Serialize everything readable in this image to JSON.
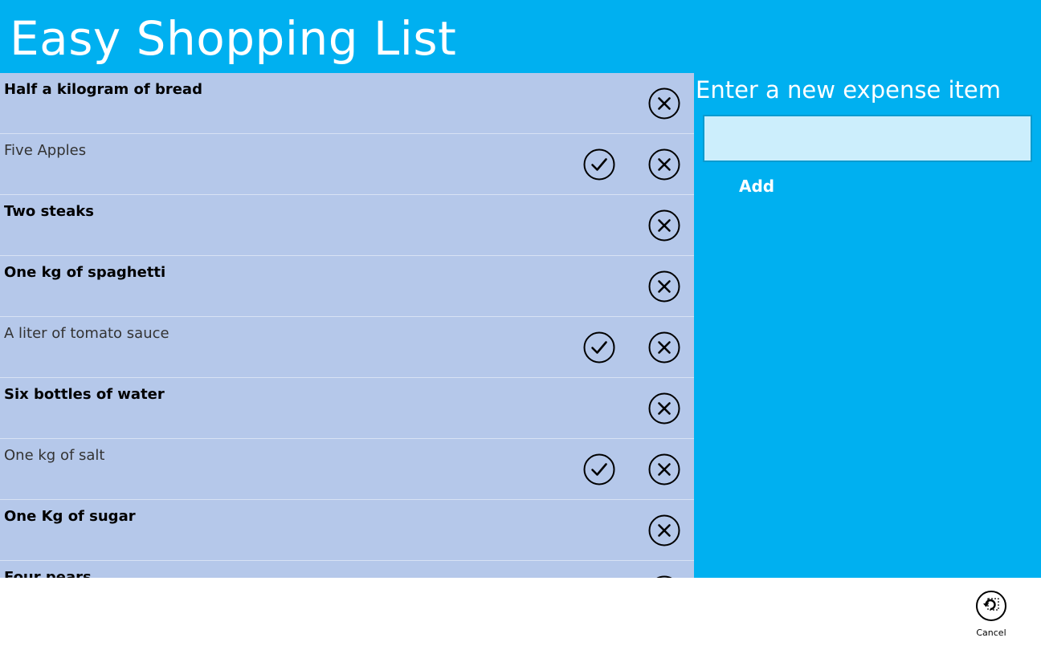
{
  "app": {
    "title": "Easy Shopping List",
    "colors": {
      "accent": "#00B0F0",
      "list_row": "#B5C8EA",
      "input_bg": "#CCEEFC",
      "input_border": "#0A9BD0"
    }
  },
  "shopping_list": {
    "items": [
      {
        "label": "Half a kilogram of bread",
        "purchased": false
      },
      {
        "label": "Five Apples",
        "purchased": true
      },
      {
        "label": "Two steaks",
        "purchased": false
      },
      {
        "label": "One kg of spaghetti",
        "purchased": false
      },
      {
        "label": "A liter of tomato sauce",
        "purchased": true
      },
      {
        "label": "Six bottles of water",
        "purchased": false
      },
      {
        "label": "One kg of salt",
        "purchased": true
      },
      {
        "label": "One Kg of sugar",
        "purchased": false
      },
      {
        "label": "Four pears",
        "purchased": false
      }
    ],
    "icons": {
      "purchased": "checkmark-circle-icon",
      "delete": "close-circle-icon"
    }
  },
  "new_item_panel": {
    "heading": "Enter a new expense item",
    "input_value": "",
    "add_label": "Add"
  },
  "app_bar": {
    "cancel_label": "Cancel",
    "cancel_icon": "undo-icon"
  }
}
